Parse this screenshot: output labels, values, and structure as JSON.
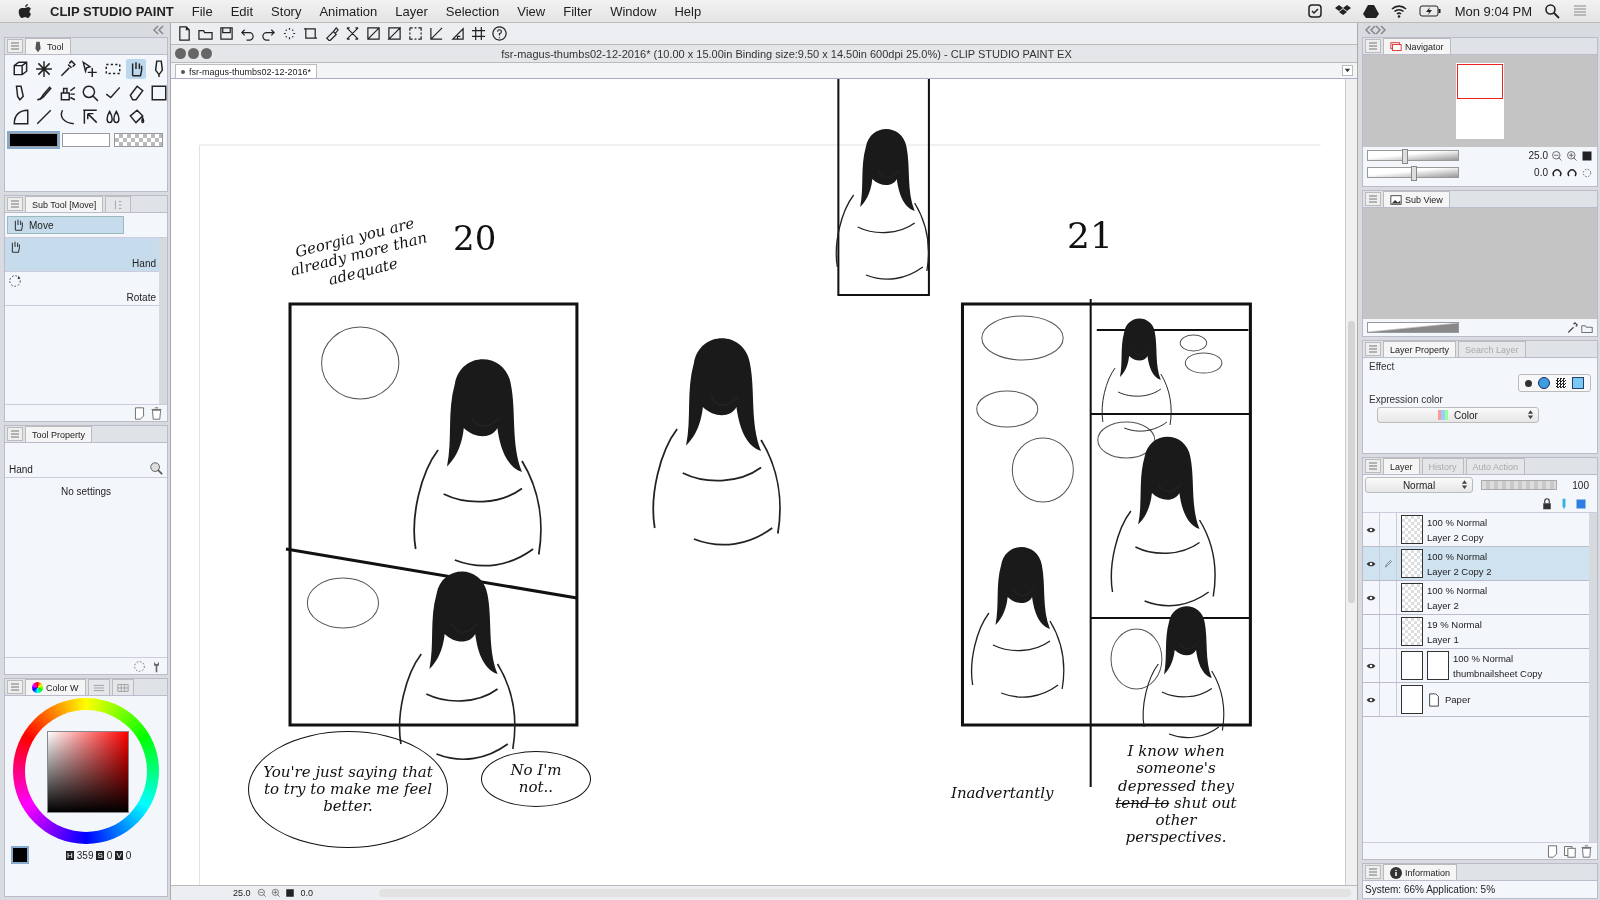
{
  "menubar": {
    "app": "CLIP STUDIO PAINT",
    "menus": [
      "File",
      "Edit",
      "Story",
      "Animation",
      "Layer",
      "Selection",
      "View",
      "Filter",
      "Window",
      "Help"
    ],
    "clock": "Mon 9:04 PM"
  },
  "document": {
    "title": "fsr-magus-thumbs02-12-2016* (10.00 x 15.00in Binding size:9.50 x 14.50in 600dpi 25.0%)  - CLIP STUDIO PAINT EX",
    "tab": "fsr-magus-thumbs02-12-2016*"
  },
  "tool_panel": {
    "tab": "Tool",
    "tools": [
      {
        "selected": false
      },
      {
        "selected": false
      },
      {
        "selected": false
      },
      {
        "selected": false
      },
      {
        "selected": false
      },
      {
        "selected": true
      },
      {
        "selected": false
      },
      {
        "selected": false
      },
      {
        "selected": false
      },
      {
        "selected": false
      },
      {
        "selected": false
      },
      {
        "selected": false
      },
      {
        "selected": false
      },
      {
        "selected": false
      },
      {
        "selected": false
      },
      {
        "selected": false
      },
      {
        "selected": false
      },
      {
        "selected": false
      },
      {
        "selected": false
      },
      {
        "selected": false
      }
    ]
  },
  "sub_tool_panel": {
    "tabs": [
      {
        "label": "Sub Tool [Move]",
        "selected": true
      },
      {
        "selected": false
      }
    ],
    "group": "Move",
    "items": [
      {
        "label": "Hand",
        "kind": "hand",
        "selected": true
      },
      {
        "label": "Rotate",
        "kind": "rotate",
        "selected": false
      }
    ]
  },
  "tool_property": {
    "tab": "Tool Property",
    "tool": "Hand",
    "message": "No settings"
  },
  "color_panel": {
    "tabs": [
      {
        "label": "Color W",
        "selected": true
      },
      {
        "selected": false
      },
      {
        "selected": false
      }
    ],
    "h_label": "H",
    "h": "359",
    "s_label": "S",
    "s": "0",
    "v_label": "V",
    "v": "0"
  },
  "navigator": {
    "tab": "Navigator",
    "zoom": "25.0",
    "zoom_slider": {
      "level": 0.4
    },
    "rotation": "0.0",
    "rotation_slider": {
      "level": 0.5
    }
  },
  "sub_view": {
    "tab": "Sub View",
    "zoom_slider": {
      "level": 1
    }
  },
  "layer_property": {
    "tabs": [
      {
        "label": "Layer Property",
        "selected": true
      },
      {
        "label": "Search Layer",
        "selected": false
      }
    ],
    "effect_label": "Effect",
    "expression_label": "Expression color",
    "expression_value": "Color"
  },
  "layer_panel": {
    "tabs": [
      {
        "label": "Layer",
        "selected": true
      },
      {
        "label": "History",
        "selected": false
      },
      {
        "label": "Auto Action",
        "selected": false
      }
    ],
    "blend_mode": "Normal",
    "opacity_slider": {
      "level": 1
    },
    "opacity": "100",
    "layers": [
      {
        "blend": "100 % Normal",
        "name": "Layer 2 Copy",
        "kind": "raster",
        "visible": true,
        "selected": false
      },
      {
        "blend": "100 % Normal",
        "name": "Layer 2 Copy 2",
        "kind": "raster",
        "visible": true,
        "selected": true
      },
      {
        "blend": "100 % Normal",
        "name": "Layer 2",
        "kind": "raster",
        "visible": true,
        "selected": false
      },
      {
        "blend": "19 % Normal",
        "name": "Layer 1",
        "kind": "raster",
        "visible": false,
        "selected": false
      },
      {
        "blend": "100 % Normal",
        "name": "thumbnailsheet Copy",
        "kind": "masked",
        "visible": true,
        "selected": false
      },
      {
        "name": "Paper",
        "kind": "paper",
        "visible": true,
        "selected": false
      }
    ]
  },
  "information": {
    "tab": "Information",
    "status": "System: 66% Application:  5%"
  },
  "canvas": {
    "notes": [
      {
        "kind": "note",
        "text": "Georgia you are already more than adequate"
      },
      {
        "kind": "page_number",
        "text": "20"
      },
      {
        "kind": "page_number",
        "text": "21"
      },
      {
        "kind": "bubble",
        "text": "You're just saying that to try to make me feel better."
      },
      {
        "kind": "bubble",
        "text": "No I'm not.."
      },
      {
        "kind": "note",
        "text": "Inadvertantly"
      },
      {
        "kind": "edited_note",
        "segments": [
          {
            "text": "I know when someone's depressed they",
            "struck": false
          },
          {
            "text": "tend to",
            "struck": true
          },
          {
            "text": "shut out other perspectives.",
            "struck": false
          }
        ]
      }
    ]
  },
  "status_bar": {
    "zoom": "25.0",
    "angle": "0.0"
  }
}
